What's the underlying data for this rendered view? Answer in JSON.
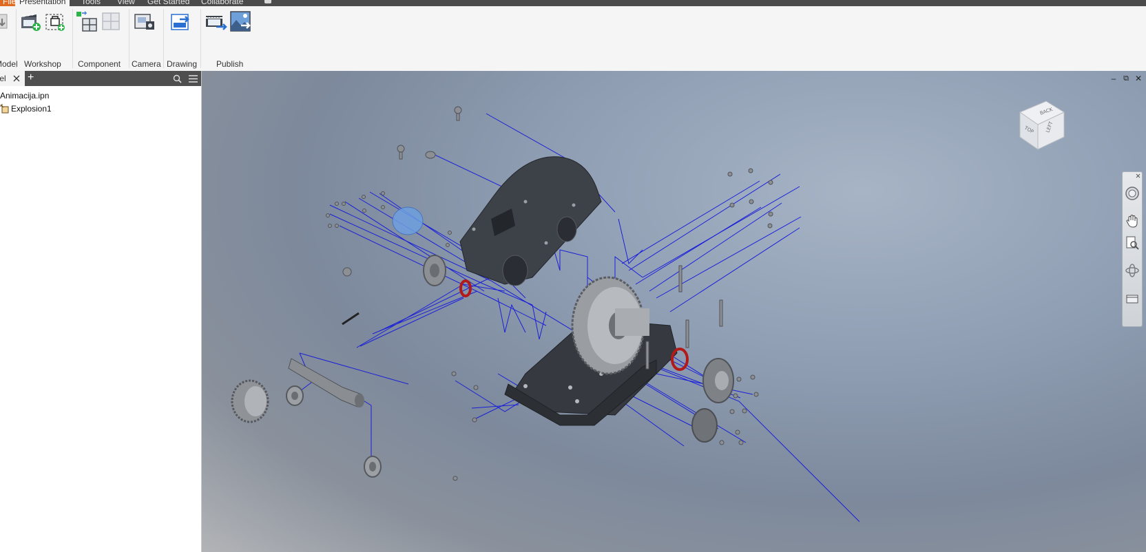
{
  "menubar": {
    "tabs": [
      {
        "label": "File",
        "state": "file"
      },
      {
        "label": "Presentation",
        "state": "active"
      },
      {
        "label": "Tools"
      },
      {
        "label": "View"
      },
      {
        "label": "Get Started"
      },
      {
        "label": "Collaborate"
      }
    ]
  },
  "ribbon": {
    "groups": [
      {
        "label": "Model"
      },
      {
        "label": "Workshop"
      },
      {
        "label": "Component"
      },
      {
        "label": "Camera"
      },
      {
        "label": "Drawing"
      },
      {
        "label": "Publish"
      }
    ],
    "icons": [
      "insert-model-icon",
      "new-storyboard-icon",
      "new-snapshot-icon",
      "tweak-components-icon",
      "fade-icon",
      "capture-camera-icon",
      "create-drawing-view-icon",
      "publish-video-icon",
      "publish-raster-icon"
    ]
  },
  "browser": {
    "tab_label": "Model",
    "add_label": "+",
    "tree": [
      {
        "label": "Animacija.ipn",
        "icon": "presentation-file-icon"
      },
      {
        "label": "Explosion1",
        "icon": "scene-icon"
      }
    ]
  },
  "viewport": {
    "viewcube_faces": [
      "TOP",
      "BACK",
      "LEFT"
    ],
    "colors": {
      "trail": "#1a1fd8",
      "oring": "#b21a1a",
      "housing": "#3d4148",
      "part": "#8c8f94"
    }
  }
}
